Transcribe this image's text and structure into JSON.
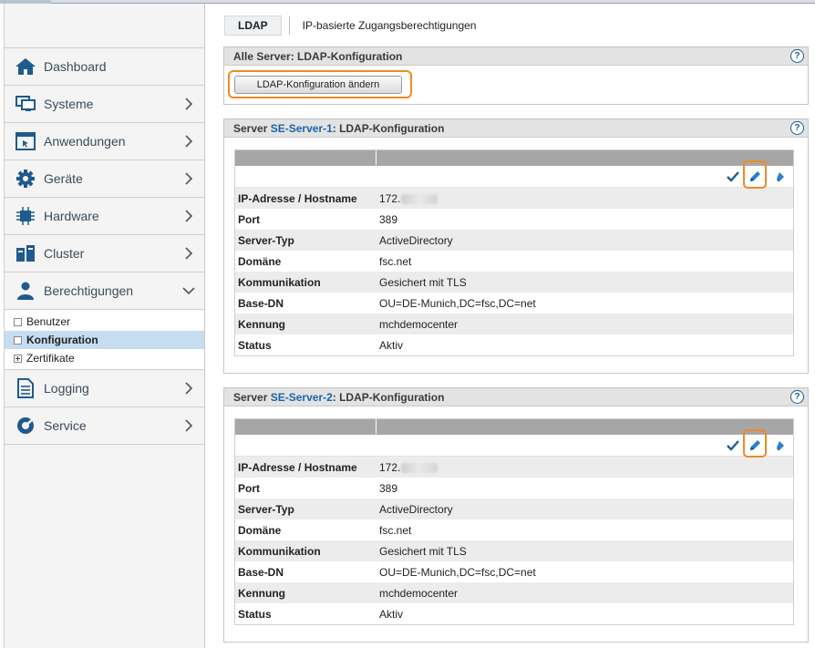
{
  "tabs": {
    "active": "LDAP",
    "other": "IP-basierte Zugangsberechtigungen"
  },
  "sidebar": {
    "items": [
      {
        "label": "Dashboard",
        "icon": "home-icon"
      },
      {
        "label": "Systeme",
        "icon": "monitor-icon"
      },
      {
        "label": "Anwendungen",
        "icon": "app-window-icon"
      },
      {
        "label": "Geräte",
        "icon": "gear-icon"
      },
      {
        "label": "Hardware",
        "icon": "chip-icon"
      },
      {
        "label": "Cluster",
        "icon": "cluster-icon"
      },
      {
        "label": "Berechtigungen",
        "icon": "user-icon"
      },
      {
        "label": "Logging",
        "icon": "document-icon"
      },
      {
        "label": "Service",
        "icon": "service-icon"
      }
    ],
    "sub": [
      "Benutzer",
      "Konfiguration",
      "Zertifikate"
    ]
  },
  "allServers": {
    "title": "Alle Server: LDAP-Konfiguration",
    "button": "LDAP-Konfiguration ändern"
  },
  "servers": [
    {
      "prefix": "Server ",
      "name": "SE-Server-1",
      "suffix": ": LDAP-Konfiguration",
      "rows": [
        {
          "k": "IP-Adresse / Hostname",
          "v": "172."
        },
        {
          "k": "Port",
          "v": "389"
        },
        {
          "k": "Server-Typ",
          "v": "ActiveDirectory"
        },
        {
          "k": "Domäne",
          "v": "fsc.net"
        },
        {
          "k": "Kommunikation",
          "v": "Gesichert mit TLS"
        },
        {
          "k": "Base-DN",
          "v": "OU=DE-Munich,DC=fsc,DC=net"
        },
        {
          "k": "Kennung",
          "v": "mchdemocenter"
        },
        {
          "k": "Status",
          "v": "Aktiv"
        }
      ]
    },
    {
      "prefix": "Server ",
      "name": "SE-Server-2",
      "suffix": ": LDAP-Konfiguration",
      "rows": [
        {
          "k": "IP-Adresse / Hostname",
          "v": "172."
        },
        {
          "k": "Port",
          "v": "389"
        },
        {
          "k": "Server-Typ",
          "v": "ActiveDirectory"
        },
        {
          "k": "Domäne",
          "v": "fsc.net"
        },
        {
          "k": "Kommunikation",
          "v": "Gesichert mit TLS"
        },
        {
          "k": "Base-DN",
          "v": "OU=DE-Munich,DC=fsc,DC=net"
        },
        {
          "k": "Kennung",
          "v": "mchdemocenter"
        },
        {
          "k": "Status",
          "v": "Aktiv"
        }
      ]
    }
  ],
  "help": "?"
}
